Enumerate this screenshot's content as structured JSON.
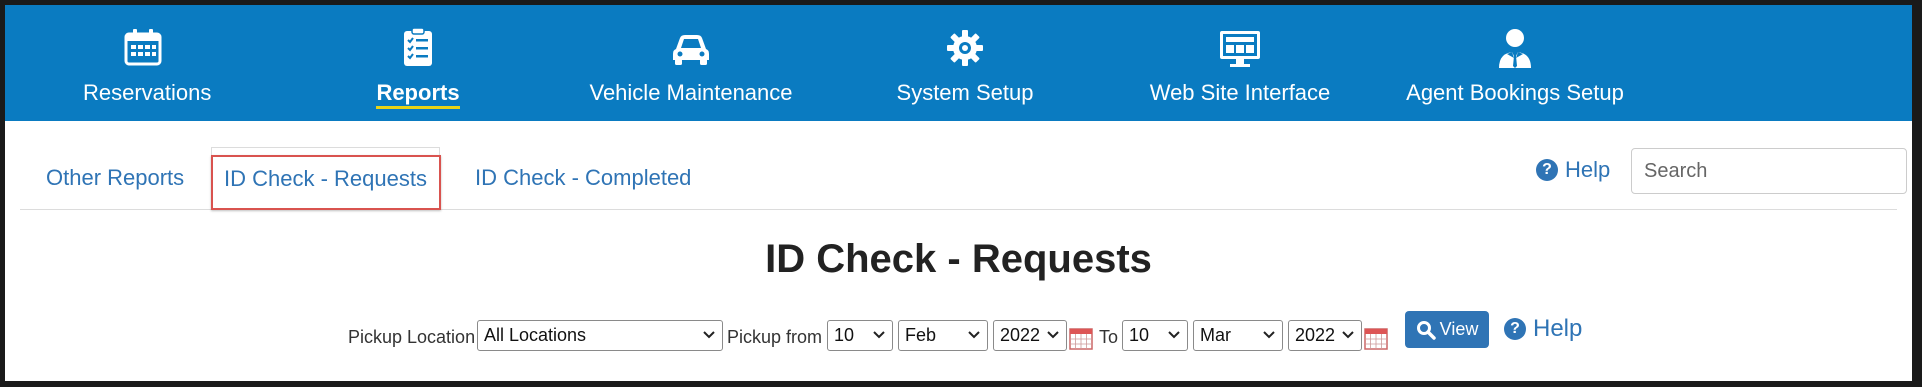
{
  "nav": {
    "items": [
      {
        "label": "Reservations",
        "icon": "calendar-icon"
      },
      {
        "label": "Reports",
        "icon": "clipboard-list-icon",
        "active": true
      },
      {
        "label": "Vehicle Maintenance",
        "icon": "car-icon"
      },
      {
        "label": "System Setup",
        "icon": "gear-icon"
      },
      {
        "label": "Web Site Interface",
        "icon": "monitor-icon"
      },
      {
        "label": "Agent Bookings Setup",
        "icon": "agent-icon"
      }
    ]
  },
  "tabs": [
    {
      "label": "Other Reports"
    },
    {
      "label": "ID Check - Requests",
      "active": true
    },
    {
      "label": "ID Check - Completed"
    }
  ],
  "help_label": "Help",
  "search": {
    "placeholder": "Search"
  },
  "page_title": "ID Check - Requests",
  "filters": {
    "pickup_location_label": "Pickup Location",
    "pickup_location_value": "All Locations",
    "pickup_from_label": "Pickup from",
    "from_day": "10",
    "from_month": "Feb",
    "from_year": "2022",
    "to_label": "To",
    "to_day": "10",
    "to_month": "Mar",
    "to_year": "2022",
    "view_label": "View",
    "help_label": "Help"
  },
  "colors": {
    "nav_bg": "#0a7bc1",
    "link": "#2f74b5",
    "active_underline": "#e8d417",
    "highlight_border": "#d9534f"
  }
}
